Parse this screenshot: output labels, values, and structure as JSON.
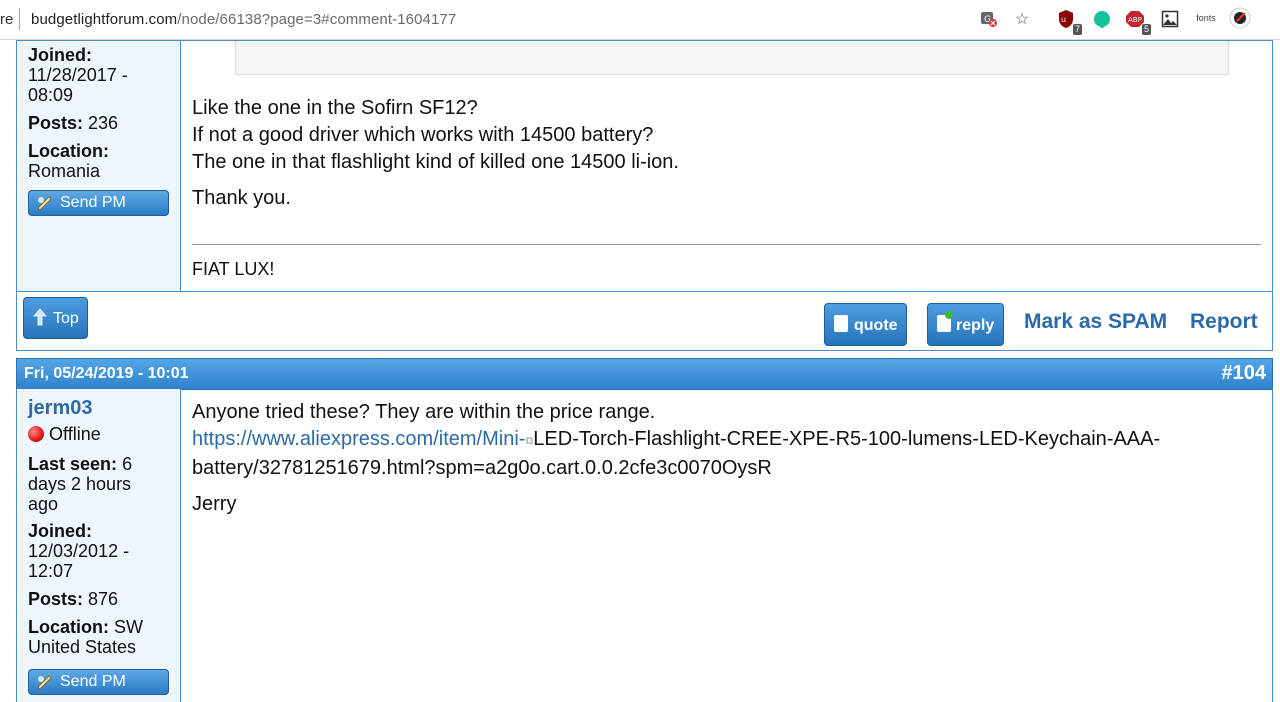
{
  "browser": {
    "url_edge": "re",
    "url_host": "budgetlightforum.com",
    "url_path": "/node/66138?page=3#comment-1604177",
    "extensions": [
      {
        "name": "ublock",
        "badge": "7"
      },
      {
        "name": "grammarly",
        "badge": ""
      },
      {
        "name": "adblock",
        "badge": "5"
      },
      {
        "name": "image",
        "badge": ""
      },
      {
        "name": "fonts",
        "label": "fonts"
      },
      {
        "name": "profile",
        "badge": ""
      }
    ]
  },
  "post1": {
    "author": {
      "joined_label": "Joined:",
      "joined_value_1": "11/28/2017 -",
      "joined_value_2": "08:09",
      "posts_label": "Posts:",
      "posts_value": "236",
      "location_label": "Location:",
      "location_value": "Romania",
      "send_pm": "Send PM"
    },
    "body": [
      "Like the one in the Sofirn SF12?",
      "If not a good driver which works with 14500 battery?",
      "The one in that flashlight kind of killed one 14500 li-ion."
    ],
    "thanks": "Thank you.",
    "signature": "FIAT LUX!",
    "top_button": "Top",
    "quote_button": "quote",
    "reply_button": "reply",
    "spam_link": "Mark as SPAM",
    "report_link": "Report"
  },
  "post2": {
    "date": "Fri, 05/24/2019 - 10:01",
    "number": "#104",
    "author": {
      "name": "jerm03",
      "status": "Offline",
      "status_color": "#e02020",
      "last_seen_label": "Last seen:",
      "last_seen_value_1": "6",
      "last_seen_value_2": "days 2 hours",
      "last_seen_value_3": "ago",
      "joined_label": "Joined:",
      "joined_value_1": "12/03/2012 -",
      "joined_value_2": "12:07",
      "posts_label": "Posts:",
      "posts_value": "876",
      "location_label": "Location:",
      "location_value_1": "SW",
      "location_value_2": "United States",
      "send_pm": "Send PM"
    },
    "body_line1": "Anyone tried these? They are within the price range.",
    "link_part1": "https://www.aliexpress.com/item/Mini-",
    "link_part2": "LED-Torch-Flashlight-CREE-XPE-R5-100-lumens-LED-Keychain-AAA-",
    "link_part3": "battery/32781251679.html?spm=a2g0o.cart.0.0.2cfe3c0070OysR",
    "signoff": "Jerry"
  },
  "colors": {
    "accent": "#2f83cc",
    "link": "#2a6aa8",
    "author_bg": "#eef5fc"
  }
}
